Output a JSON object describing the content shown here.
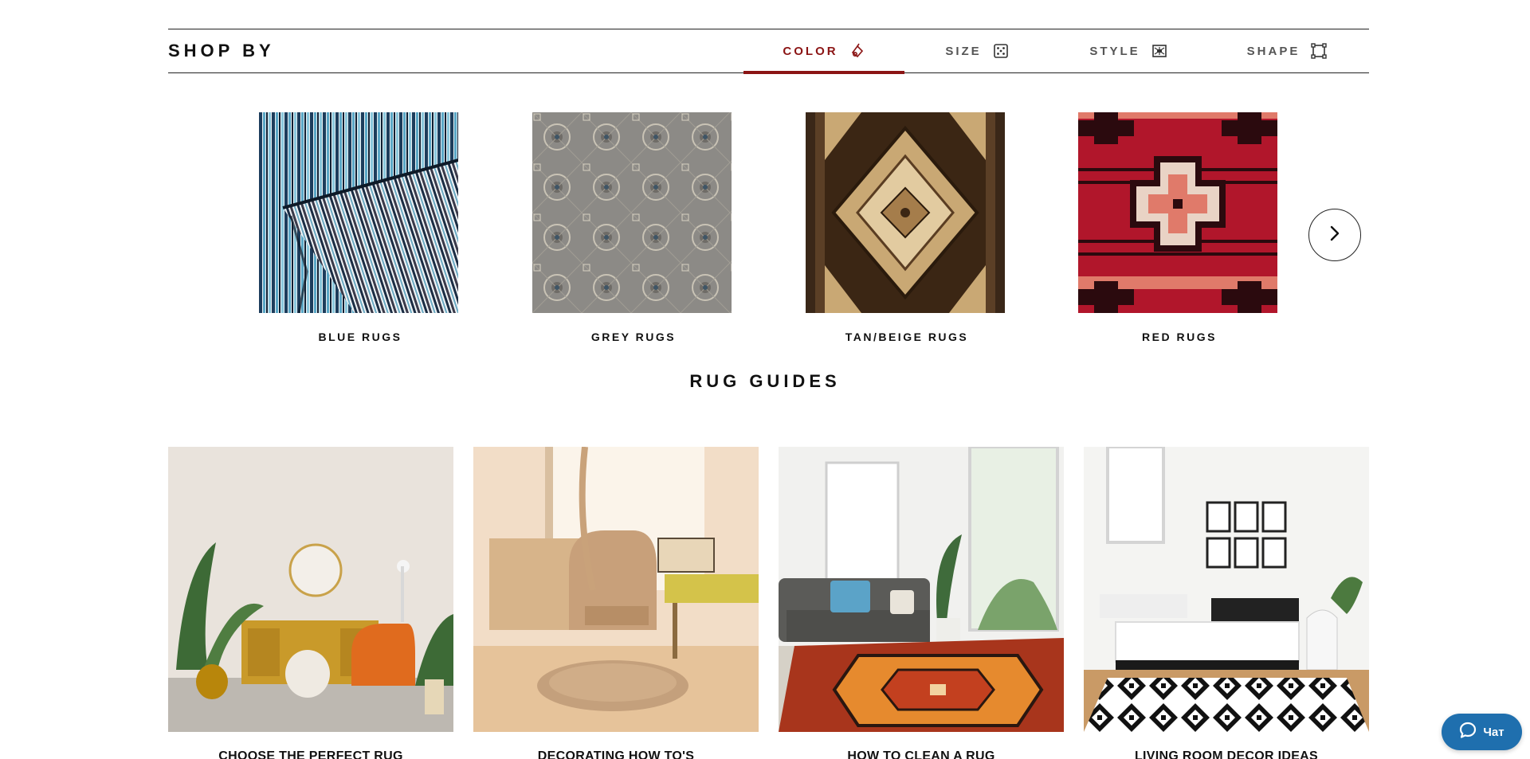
{
  "shop_by": {
    "title": "SHOP BY",
    "tabs": [
      {
        "label": "COLOR",
        "icon": "color-palette-icon",
        "active": true
      },
      {
        "label": "SIZE",
        "icon": "size-dice-icon",
        "active": false
      },
      {
        "label": "STYLE",
        "icon": "style-pattern-icon",
        "active": false
      },
      {
        "label": "SHAPE",
        "icon": "shape-square-icon",
        "active": false
      }
    ],
    "accent_color": "#8b1414"
  },
  "categories": [
    {
      "label": "BLUE RUGS"
    },
    {
      "label": "GREY RUGS"
    },
    {
      "label": "TAN/BEIGE RUGS"
    },
    {
      "label": "RED RUGS"
    }
  ],
  "next_icon": "chevron-right-icon",
  "guides": {
    "title": "RUG GUIDES",
    "items": [
      {
        "label": "CHOOSE THE PERFECT RUG"
      },
      {
        "label": "DECORATING HOW TO'S"
      },
      {
        "label": "HOW TO CLEAN A RUG"
      },
      {
        "label": "LIVING ROOM DECOR IDEAS"
      }
    ]
  },
  "chat": {
    "label": "Чат",
    "icon": "chat-bubble-icon",
    "color": "#1f6fae"
  }
}
